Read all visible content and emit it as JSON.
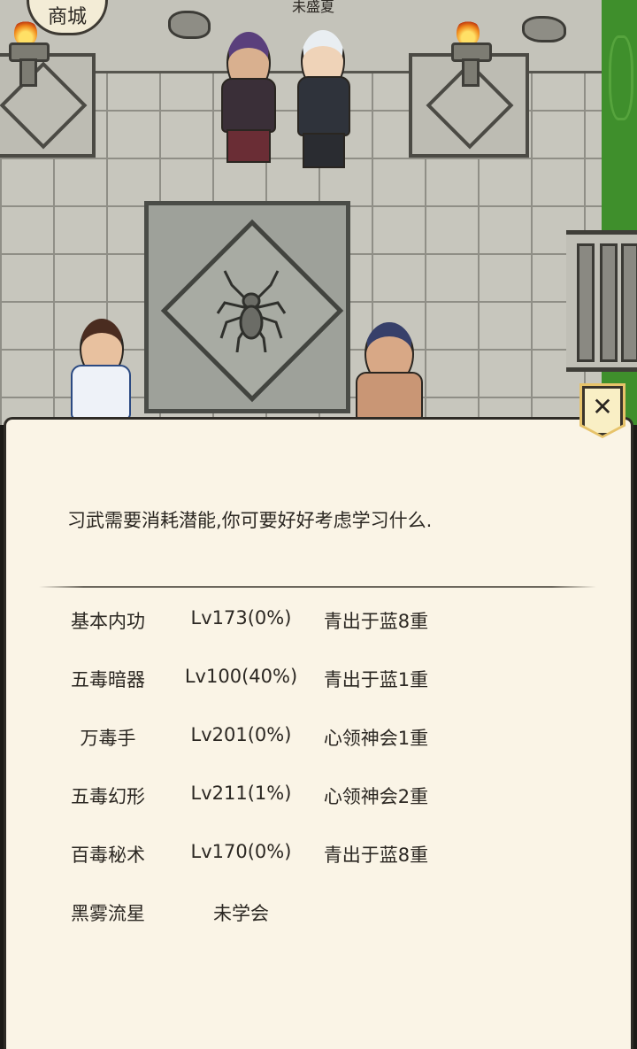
{
  "scene": {
    "shop_label": "商城",
    "npc_name": "未盛夏"
  },
  "dialog": {
    "message": "习武需要消耗潜能,你可要好好考虑学习什么.",
    "close_glyph": "✕",
    "skills": [
      {
        "name": "基本内功",
        "level": "Lv173(0%)",
        "stage": "青出于蓝8重"
      },
      {
        "name": "五毒暗器",
        "level": "Lv100(40%)",
        "stage": "青出于蓝1重"
      },
      {
        "name": "万毒手",
        "level": "Lv201(0%)",
        "stage": "心领神会1重"
      },
      {
        "name": "五毒幻形",
        "level": "Lv211(1%)",
        "stage": "心领神会2重"
      },
      {
        "name": "百毒秘术",
        "level": "Lv170(0%)",
        "stage": "青出于蓝8重"
      },
      {
        "name": "黑雾流星",
        "level": "未学会",
        "stage": ""
      }
    ]
  },
  "colors": {
    "panel_bg": "#faf4e6",
    "grass": "#3f8f2c",
    "close_tab": "#f9efc5"
  }
}
